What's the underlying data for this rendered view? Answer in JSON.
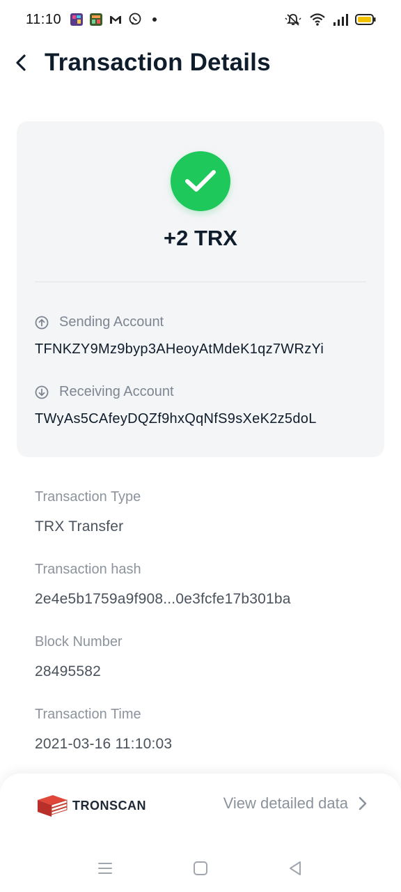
{
  "status_bar": {
    "time": "11:10",
    "notification_icons": [
      "app-icon-1",
      "app-icon-2",
      "gmail-icon",
      "viber-icon",
      "dot-icon"
    ],
    "right_icons": [
      "muted-bell-icon",
      "wifi-icon",
      "signal-icon",
      "battery-icon"
    ]
  },
  "header": {
    "title": "Transaction Details"
  },
  "summary": {
    "amount": "+2 TRX",
    "status": "success",
    "sending_label": "Sending Account",
    "sending_value": "TFNKZY9Mz9byp3AHeoyAtMdeK1qz7WRzYi",
    "receiving_label": "Receiving Account",
    "receiving_value": "TWyAs5CAfeyDQZf9hxQqNfS9sXeK2z5doL"
  },
  "details": {
    "type_label": "Transaction Type",
    "type_value": "TRX Transfer",
    "hash_label": "Transaction hash",
    "hash_value": "2e4e5b1759a9f908...0e3fcfe17b301ba",
    "block_label": "Block Number",
    "block_value": "28495582",
    "time_label": "Transaction Time",
    "time_value": "2021-03-16 11:10:03"
  },
  "footer": {
    "brand": "TRONSCAN",
    "link": "View detailed data"
  },
  "colors": {
    "success": "#1ec85a",
    "brand_red": "#c0392b",
    "card_bg": "#f4f5f7"
  }
}
